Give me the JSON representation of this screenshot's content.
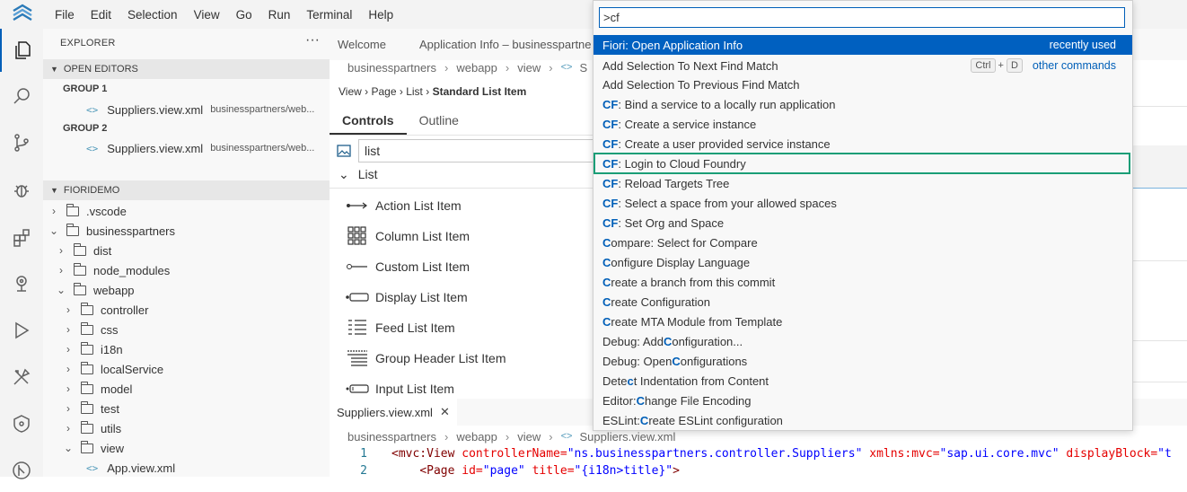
{
  "menu": [
    "File",
    "Edit",
    "Selection",
    "View",
    "Go",
    "Run",
    "Terminal",
    "Help"
  ],
  "explorer": {
    "title": "EXPLORER",
    "more": "···",
    "open_editors": "OPEN EDITORS",
    "group1": "GROUP 1",
    "group2": "GROUP 2",
    "editor1_name": "Suppliers.view.xml",
    "editor1_path": "businesspartners/web...",
    "editor2_name": "Suppliers.view.xml",
    "editor2_path": "businesspartners/web...",
    "workspace": "FIORIDEMO",
    "tree": [
      ".vscode",
      "businesspartners",
      "dist",
      "node_modules",
      "webapp",
      "controller",
      "css",
      "i18n",
      "localService",
      "model",
      "test",
      "utils",
      "view",
      "App.view.xml"
    ]
  },
  "tabs": {
    "welcome": "Welcome",
    "appinfo": "Application Info – businesspartne"
  },
  "breadcrumb1": [
    "businesspartners",
    "webapp",
    "view",
    "S"
  ],
  "prop_breadcrumb": {
    "view": "View",
    "page": "Page",
    "list": "List",
    "item": "Standard List Item"
  },
  "panel_tabs": {
    "controls": "Controls",
    "outline": "Outline"
  },
  "search_value": "list",
  "list_header": "List",
  "controls": [
    "Action List Item",
    "Column List Item",
    "Custom List Item",
    "Display List Item",
    "Feed List Item",
    "Group Header List Item",
    "Input List Item"
  ],
  "editor_tab": "Suppliers.view.xml",
  "breadcrumb2": [
    "businesspartners",
    "webapp",
    "view",
    "Suppliers.view.xml"
  ],
  "code": {
    "line1_no": "1",
    "line1_tag": "<mvc:View",
    "line1_a1": "controllerName=",
    "line1_v1": "\"ns.businesspartners.controller.Suppliers\"",
    "line1_a2": "xmlns:mvc=",
    "line1_v2": "\"sap.ui.core.mvc\"",
    "line1_a3": "displayBlock=",
    "line1_v3": "\"t",
    "line2_no": "2",
    "line2_tag": "<Page",
    "line2_a1": "id=",
    "line2_v1": "\"page\"",
    "line2_a2": "title=",
    "line2_v2": "\"{i18n>title}\"",
    "line2_end": ">"
  },
  "palette": {
    "input": ">cf",
    "recently_used": "recently used",
    "other_commands": "other commands",
    "kbd_ctrl": "Ctrl",
    "kbd_plus": "+",
    "kbd_d": "D"
  },
  "commands": [
    {
      "pre": "Fiori: Open Application Info",
      "hl": "",
      "post": ""
    },
    {
      "pre": "Add Selection To Next Find Match",
      "hl": "",
      "post": ""
    },
    {
      "pre": "Add Selection To Previous Find Match",
      "hl": "",
      "post": ""
    },
    {
      "pre": "",
      "hl": "CF",
      "post": ": Bind a service to a locally run application"
    },
    {
      "pre": "",
      "hl": "CF",
      "post": ": Create a service instance"
    },
    {
      "pre": "",
      "hl": "CF",
      "post": ": Create a user provided service instance"
    },
    {
      "pre": "",
      "hl": "CF",
      "post": ": Login to Cloud Foundry"
    },
    {
      "pre": "",
      "hl": "CF",
      "post": ": Reload Targets Tree"
    },
    {
      "pre": "",
      "hl": "CF",
      "post": ": Select a space from your allowed spaces"
    },
    {
      "pre": "",
      "hl": "CF",
      "post": ": Set Org and Space"
    },
    {
      "pre": "",
      "hl": "C",
      "post": "ompare: Select for Compare"
    },
    {
      "pre": "",
      "hl": "C",
      "post": "onfigure Display Language"
    },
    {
      "pre": "",
      "hl": "C",
      "post": "reate a branch from this commit"
    },
    {
      "pre": "",
      "hl": "C",
      "post": "reate Configuration"
    },
    {
      "pre": "",
      "hl": "C",
      "post": "reate MTA Module from Template"
    },
    {
      "pre": "Debug: Add ",
      "hl": "C",
      "post": "onfiguration..."
    },
    {
      "pre": "Debug: Open ",
      "hl": "C",
      "post": "onfigurations"
    },
    {
      "pre": "Dete",
      "hl": "c",
      "post": "t Indentation from Content"
    },
    {
      "pre": "Editor: ",
      "hl": "C",
      "post": "hange File Encoding"
    },
    {
      "pre": "ESLint: ",
      "hl": "C",
      "post": "reate ESLint configuration"
    }
  ],
  "colors": {
    "accent": "#005fb8",
    "selection": "#0060c0",
    "highlight_box": "#1a9e77"
  },
  "icons": [
    "files-icon",
    "search-icon",
    "source-control-icon",
    "debug-icon",
    "extensions-icon",
    "remote-icon",
    "run-icon",
    "tools-icon",
    "deploy-icon",
    "git-icon"
  ]
}
